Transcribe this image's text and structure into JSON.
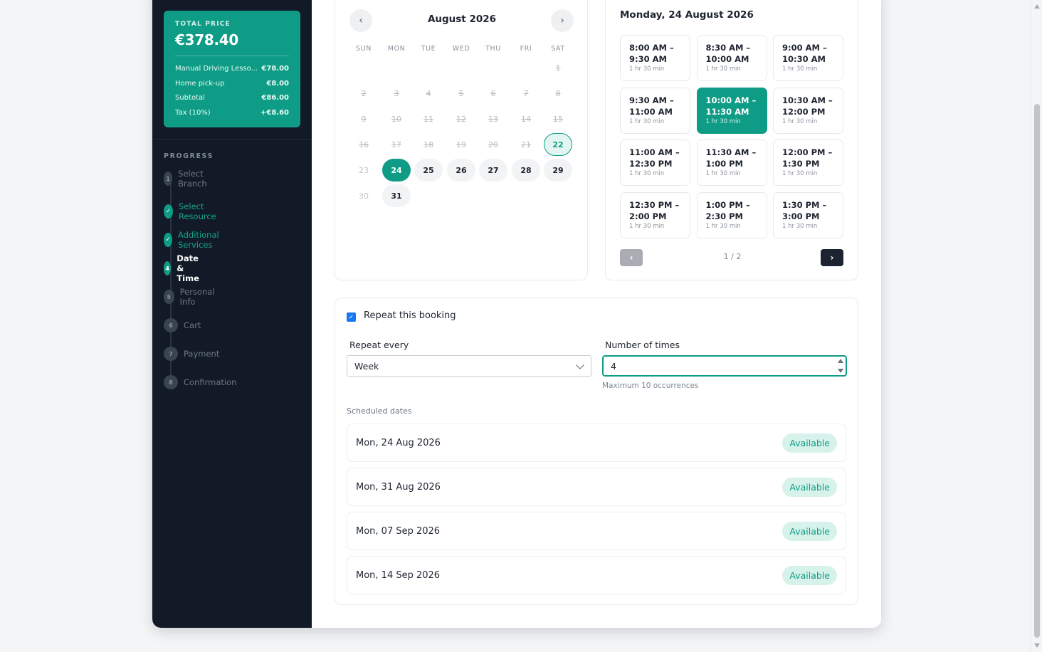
{
  "summary": {
    "total_label": "TOTAL PRICE",
    "total": "€378.40",
    "rows": [
      {
        "label": "Manual Driving Lesso...",
        "value": "€78.00"
      },
      {
        "label": "Home pick-up",
        "value": "€8.00"
      },
      {
        "label": "Subtotal",
        "value": "€86.00"
      },
      {
        "label": "Tax (10%)",
        "value": "+€8.60"
      }
    ]
  },
  "progress": {
    "title": "PROGRESS",
    "steps": [
      {
        "marker": "1",
        "label": "Select Branch",
        "state": "pending"
      },
      {
        "marker": "✓",
        "label": "Select Resource",
        "state": "done"
      },
      {
        "marker": "✓",
        "label": "Additional Services",
        "state": "done"
      },
      {
        "marker": "4",
        "label": "Date & Time",
        "state": "active"
      },
      {
        "marker": "5",
        "label": "Personal Info",
        "state": "pending"
      },
      {
        "marker": "6",
        "label": "Cart",
        "state": "pending"
      },
      {
        "marker": "7",
        "label": "Payment",
        "state": "pending"
      },
      {
        "marker": "8",
        "label": "Confirmation",
        "state": "pending"
      }
    ]
  },
  "calendar": {
    "month_title": "August 2026",
    "prev_icon": "chevron-left-icon",
    "next_icon": "chevron-right-icon",
    "weekdays": [
      "SUN",
      "MON",
      "TUE",
      "WED",
      "THU",
      "FRI",
      "SAT"
    ],
    "weeks": [
      [
        null,
        null,
        null,
        null,
        null,
        null,
        {
          "day": "1",
          "state": "past"
        }
      ],
      [
        {
          "day": "2",
          "state": "past"
        },
        {
          "day": "3",
          "state": "past"
        },
        {
          "day": "4",
          "state": "past"
        },
        {
          "day": "5",
          "state": "past"
        },
        {
          "day": "6",
          "state": "past"
        },
        {
          "day": "7",
          "state": "past"
        },
        {
          "day": "8",
          "state": "past"
        }
      ],
      [
        {
          "day": "9",
          "state": "past"
        },
        {
          "day": "10",
          "state": "past"
        },
        {
          "day": "11",
          "state": "past"
        },
        {
          "day": "12",
          "state": "past"
        },
        {
          "day": "13",
          "state": "past"
        },
        {
          "day": "14",
          "state": "past"
        },
        {
          "day": "15",
          "state": "past"
        }
      ],
      [
        {
          "day": "16",
          "state": "past"
        },
        {
          "day": "17",
          "state": "past"
        },
        {
          "day": "18",
          "state": "past"
        },
        {
          "day": "19",
          "state": "past"
        },
        {
          "day": "20",
          "state": "past"
        },
        {
          "day": "21",
          "state": "past"
        },
        {
          "day": "22",
          "state": "today"
        }
      ],
      [
        {
          "day": "23",
          "state": "muted"
        },
        {
          "day": "24",
          "state": "selected"
        },
        {
          "day": "25",
          "state": "avail"
        },
        {
          "day": "26",
          "state": "avail"
        },
        {
          "day": "27",
          "state": "avail"
        },
        {
          "day": "28",
          "state": "avail"
        },
        {
          "day": "29",
          "state": "avail"
        }
      ],
      [
        {
          "day": "30",
          "state": "muted"
        },
        {
          "day": "31",
          "state": "avail"
        },
        null,
        null,
        null,
        null,
        null
      ]
    ]
  },
  "slots": {
    "date_title": "Monday, 24 August 2026",
    "items": [
      {
        "time": "8:00 AM –\n9:30 AM",
        "duration": "1 hr 30 min",
        "selected": false
      },
      {
        "time": "8:30 AM –\n10:00 AM",
        "duration": "1 hr 30 min",
        "selected": false
      },
      {
        "time": "9:00 AM –\n10:30 AM",
        "duration": "1 hr 30 min",
        "selected": false
      },
      {
        "time": "9:30 AM –\n11:00 AM",
        "duration": "1 hr 30 min",
        "selected": false
      },
      {
        "time": "10:00 AM –\n11:30 AM",
        "duration": "1 hr 30 min",
        "selected": true
      },
      {
        "time": "10:30 AM –\n12:00 PM",
        "duration": "1 hr 30 min",
        "selected": false
      },
      {
        "time": "11:00 AM –\n12:30 PM",
        "duration": "1 hr 30 min",
        "selected": false
      },
      {
        "time": "11:30 AM –\n1:00 PM",
        "duration": "1 hr 30 min",
        "selected": false
      },
      {
        "time": "12:00 PM –\n1:30 PM",
        "duration": "1 hr 30 min",
        "selected": false
      },
      {
        "time": "12:30 PM –\n2:00 PM",
        "duration": "1 hr 30 min",
        "selected": false
      },
      {
        "time": "1:00 PM –\n2:30 PM",
        "duration": "1 hr 30 min",
        "selected": false
      },
      {
        "time": "1:30 PM –\n3:00 PM",
        "duration": "1 hr 30 min",
        "selected": false
      }
    ],
    "page_label": "1 / 2",
    "prev_icon": "chevron-left-icon",
    "next_icon": "chevron-right-icon"
  },
  "repeat": {
    "checkbox_label": "Repeat this booking",
    "checked": true,
    "repeat_every_label": "Repeat every",
    "repeat_every_value": "Week",
    "times_label": "Number of times",
    "times_value": "4",
    "hint": "Maximum 10 occurrences",
    "scheduled_title": "Scheduled dates",
    "dates": [
      {
        "date": "Mon, 24 Aug 2026",
        "status": "Available"
      },
      {
        "date": "Mon, 31 Aug 2026",
        "status": "Available"
      },
      {
        "date": "Mon, 07 Sep 2026",
        "status": "Available"
      },
      {
        "date": "Mon, 14 Sep 2026",
        "status": "Available"
      }
    ]
  },
  "colors": {
    "accent": "#0f9c86",
    "sidebar_bg": "#111a26",
    "available_badge_bg": "#d6f2ea",
    "checkbox": "#1877f2"
  }
}
